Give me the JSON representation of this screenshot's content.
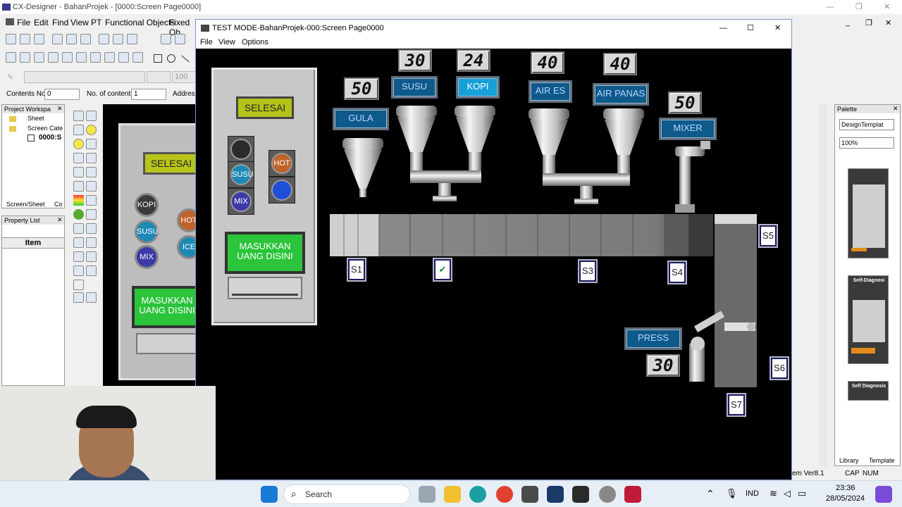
{
  "bg_window": {
    "title": "CX-Designer - BahanProjek - [0000:Screen Page0000]",
    "menu": [
      "File",
      "Edit",
      "Find",
      "View",
      "PT",
      "Functional Objects",
      "Fixed Ob"
    ],
    "contents_no_label": "Contents No.",
    "contents_no_value": "0",
    "no_of_contents_label": "No. of contents",
    "no_of_contents_value": "1",
    "address_label": "Address",
    "zoom_field": "100",
    "project_workspace": {
      "title": "Project Workspa",
      "items": [
        "Sheet",
        "Screen Cate",
        "0000:S"
      ],
      "tabs": [
        "Screen/Sheet",
        "Co"
      ]
    },
    "property_list": {
      "title": "Property List",
      "column": "Item"
    },
    "palette": {
      "title": "Palette",
      "dropdown": "DesignTemplat",
      "zoom": "100%",
      "tabs": [
        "Library",
        "Template"
      ]
    },
    "status": {
      "version": "em Ver8.1",
      "caps": "CAP",
      "num": "NUM"
    },
    "preview_panel": {
      "selesai": "SELESAI",
      "buttons": [
        "KOPI",
        "SUSU",
        "MIX",
        "HOT",
        "ICE"
      ],
      "money": "MASUKKAN UANG DISINI"
    },
    "palette_items": {
      "title1": "Self-Diagnosi",
      "title2": "Self Diagnosis"
    }
  },
  "sim_window": {
    "title": "TEST MODE-BahanProjek-000:Screen Page0000",
    "menu": [
      "File",
      "View",
      "Options"
    ],
    "panel": {
      "selesai": "SELESAI",
      "buttons": [
        {
          "label": "",
          "color": "#2a2a2a"
        },
        {
          "label": "HOT",
          "color": "#c0622a"
        },
        {
          "label": "SUSU",
          "color": "#1c8ab5"
        },
        {
          "label": "",
          "color": "#1e4fd8"
        },
        {
          "label": "MIX",
          "color": "#3b3ba8"
        }
      ],
      "money": "MASUKKAN UANG DISINI"
    },
    "ingredients": [
      {
        "label": "GULA",
        "value": "50"
      },
      {
        "label": "SUSU",
        "value": "30"
      },
      {
        "label": "KOPI",
        "value": "24"
      },
      {
        "label": "AIR ES",
        "value": "40"
      },
      {
        "label": "AIR PANAS",
        "value": "40"
      },
      {
        "label": "MIXER",
        "value": "50"
      }
    ],
    "press": {
      "label": "PRESS",
      "value": "30"
    },
    "sensors": [
      "S1",
      "",
      "S3",
      "S4",
      "S5",
      "S6",
      "S7"
    ],
    "window_controls": {
      "minimize": "—",
      "maximize": "☐",
      "close": "✕"
    }
  },
  "taskbar": {
    "search_placeholder": "Search",
    "language": "IND",
    "time": "23:36",
    "date": "28/05/2024"
  },
  "colors": {
    "accent_blue": "#0e5a8a",
    "lcd": "#d8d8d8",
    "green_button": "#2bc43a",
    "yellow_button": "#b5c21a"
  }
}
